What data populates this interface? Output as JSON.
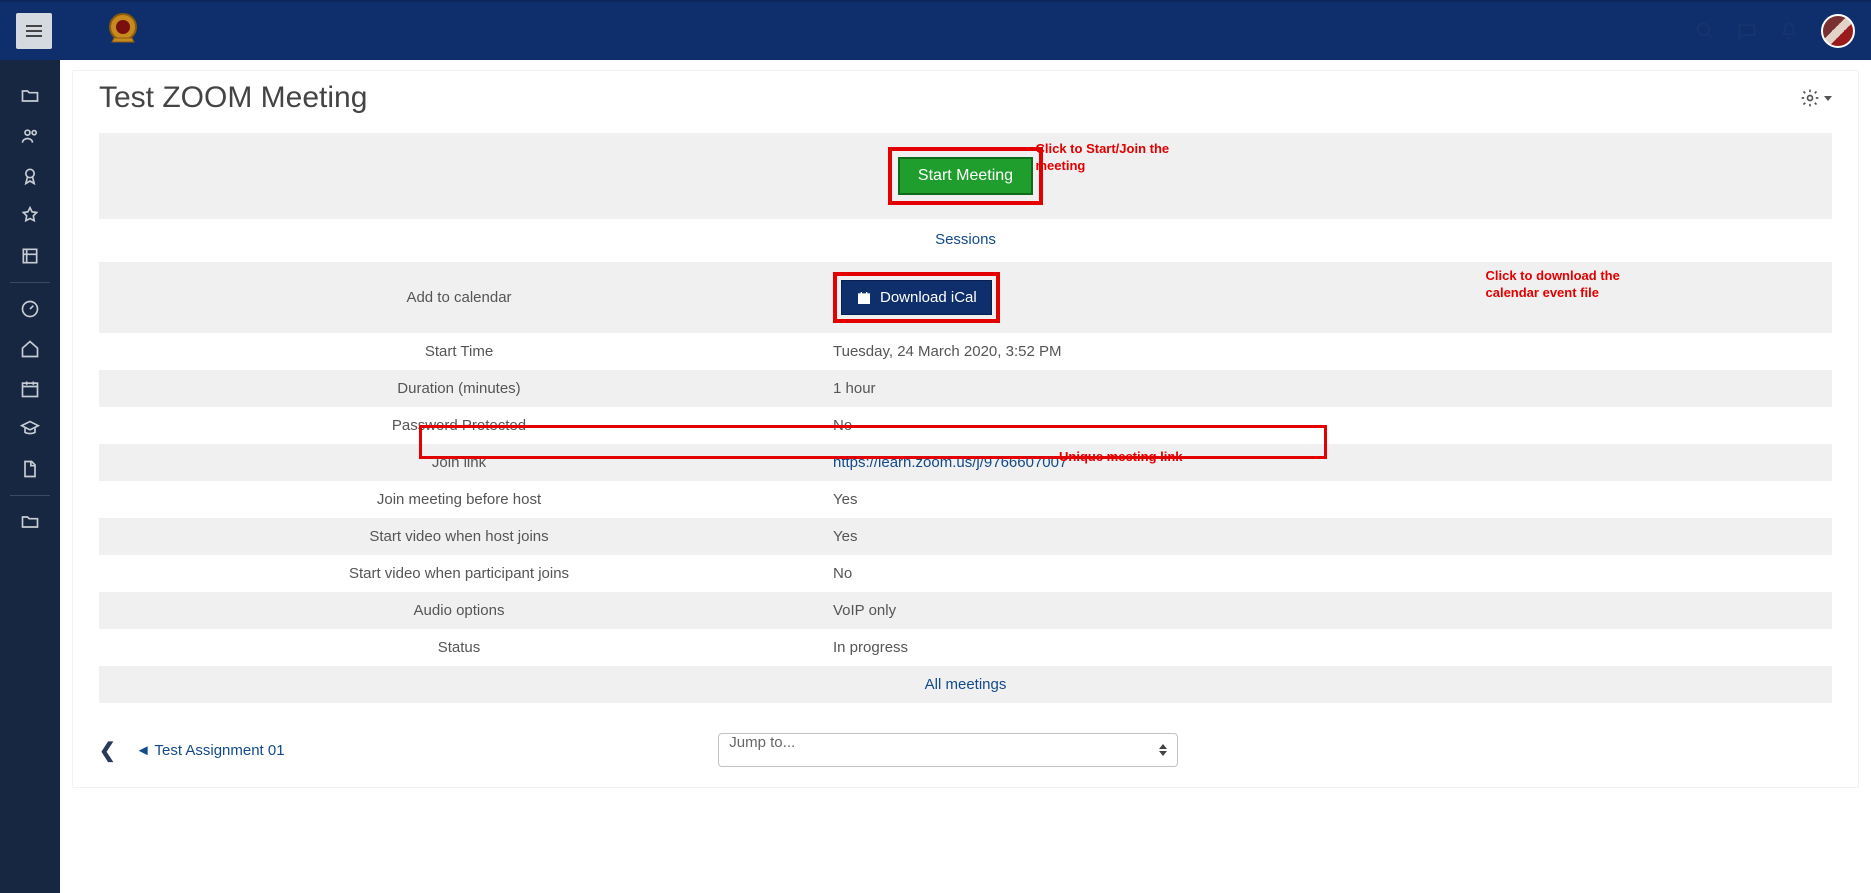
{
  "page": {
    "title": "Test ZOOM Meeting",
    "sessions_label": "Sessions",
    "all_meetings": "All meetings",
    "jump_to_placeholder": "Jump to...",
    "prev_activity": "◄ Test Assignment 01"
  },
  "buttons": {
    "start_meeting": "Start Meeting",
    "download_ical": "Download iCal"
  },
  "annotations": {
    "start": "Click to Start/Join the meeting",
    "ical": "Click to download the calendar event file",
    "joinlink": "Unique meeting link"
  },
  "rows": {
    "add_to_calendar": {
      "label": "Add to calendar"
    },
    "start_time": {
      "label": "Start Time",
      "value": "Tuesday, 24 March 2020, 3:52 PM"
    },
    "duration": {
      "label": "Duration (minutes)",
      "value": "1 hour"
    },
    "password": {
      "label": "Password Protected",
      "value": "No"
    },
    "join_link": {
      "label": "Join link",
      "value": "https://learn.zoom.us/j/9766607007"
    },
    "join_before_host": {
      "label": "Join meeting before host",
      "value": "Yes"
    },
    "host_video": {
      "label": "Start video when host joins",
      "value": "Yes"
    },
    "participant_video": {
      "label": "Start video when participant joins",
      "value": "No"
    },
    "audio": {
      "label": "Audio options",
      "value": "VoIP only"
    },
    "status": {
      "label": "Status",
      "value": "In progress"
    }
  }
}
